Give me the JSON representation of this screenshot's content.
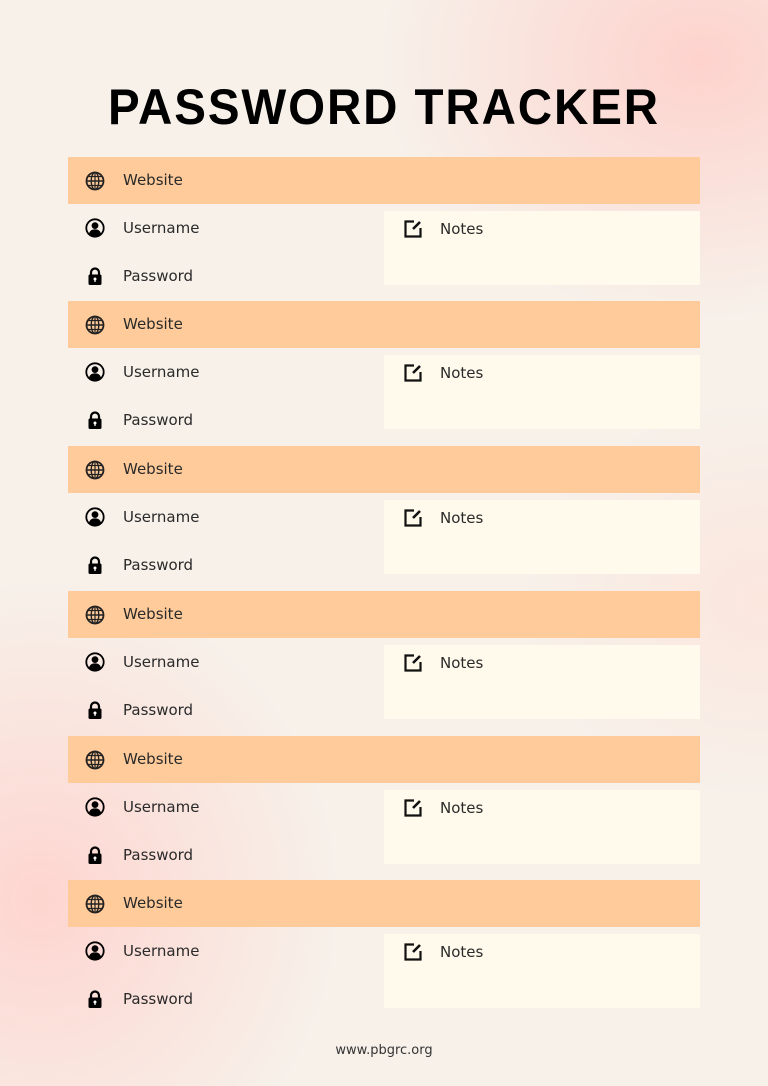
{
  "title": "PASSWORD TRACKER",
  "entries": [
    {
      "website_label": "Website",
      "username_label": "Username",
      "password_label": "Password",
      "notes_label": "Notes"
    },
    {
      "website_label": "Website",
      "username_label": "Username",
      "password_label": "Password",
      "notes_label": "Notes"
    },
    {
      "website_label": "Website",
      "username_label": "Username",
      "password_label": "Password",
      "notes_label": "Notes"
    },
    {
      "website_label": "Website",
      "username_label": "Username",
      "password_label": "Password",
      "notes_label": "Notes"
    },
    {
      "website_label": "Website",
      "username_label": "Username",
      "password_label": "Password",
      "notes_label": "Notes"
    },
    {
      "website_label": "Website",
      "username_label": "Username",
      "password_label": "Password",
      "notes_label": "Notes"
    }
  ],
  "icons": {
    "website": "globe-icon",
    "username": "user-circle-icon",
    "password": "lock-icon",
    "notes": "edit-note-icon"
  },
  "colors": {
    "website_bar": "#ffcb9a",
    "notes_box": "#fffaec",
    "background": "#f7f1ea"
  },
  "footer": "www.pbgrc.org"
}
